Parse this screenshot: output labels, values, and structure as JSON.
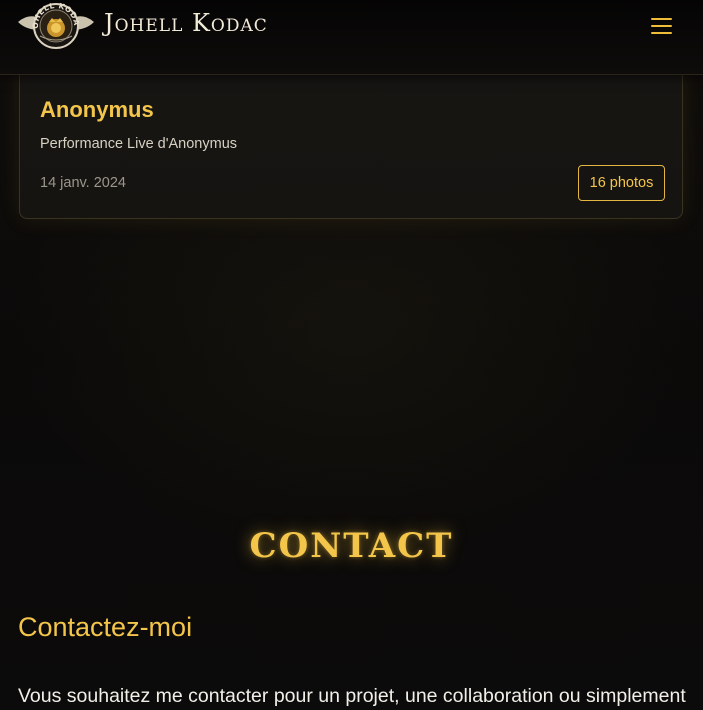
{
  "header": {
    "brand": "Johell Kodac",
    "logo_text": "JOHELL KODAC",
    "menu_icon": "hamburger-icon"
  },
  "gallery_card": {
    "title": "Anonymus",
    "description": "Performance Live d'Anonymus",
    "date": "14 janv. 2024",
    "photos_label": "16 photos"
  },
  "contact": {
    "heading": "CONTACT",
    "subheading": "Contactez-moi",
    "intro": "Vous souhaitez me contacter pour un projet, une collaboration ou simplement"
  },
  "colors": {
    "accent": "#f3c54a",
    "background": "#0b0a0a",
    "text": "#f2efe8"
  }
}
